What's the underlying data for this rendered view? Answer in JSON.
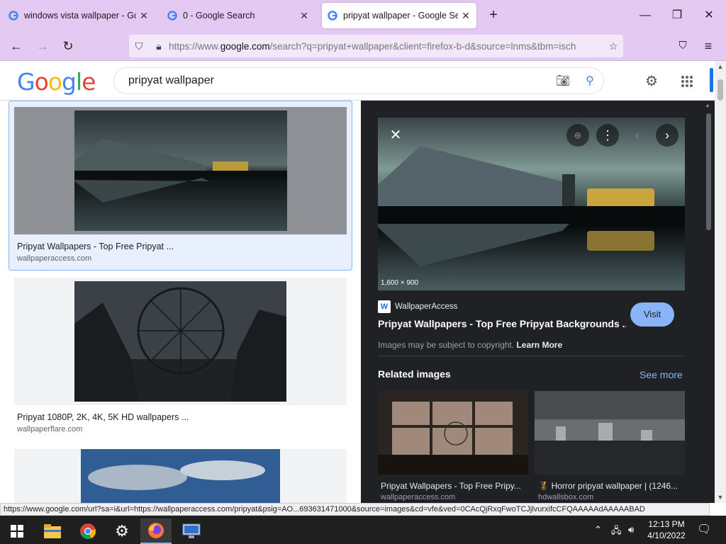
{
  "tabs": [
    {
      "title": "windows vista wallpaper - Goog",
      "active": false
    },
    {
      "title": "0 - Google Search",
      "active": false
    },
    {
      "title": "pripyat wallpaper - Google Sear",
      "active": true
    }
  ],
  "address": {
    "prefix": "https://www.",
    "domain": "google.com",
    "rest": "/search?q=pripyat+wallpaper&client=firefox-b-d&source=lnms&tbm=isch"
  },
  "google": {
    "logo": [
      "G",
      "o",
      "o",
      "g",
      "l",
      "e"
    ],
    "logo_colors": [
      "#4285f4",
      "#ea4335",
      "#fbbc05",
      "#4285f4",
      "#34a853",
      "#ea4335"
    ],
    "query": "pripyat wallpaper"
  },
  "results": [
    {
      "title": "Pripyat Wallpapers - Top Free Pripyat ...",
      "source": "wallpaperaccess.com"
    },
    {
      "title": "Pripyat 1080P, 2K, 4K, 5K HD wallpapers ...",
      "source": "wallpaperflare.com"
    }
  ],
  "panel": {
    "dimensions": "1,600 × 900",
    "source_name": "WallpaperAccess",
    "title": "Pripyat Wallpapers - Top Free Pripyat Backgrounds ...",
    "visit_label": "Visit",
    "copyright": "Images may be subject to copyright.",
    "learn_more": "Learn More",
    "related_heading": "Related images",
    "see_more": "See more",
    "related": [
      {
        "title": "Pripyat Wallpapers - Top Free Pripy...",
        "source": "wallpaperaccess.com"
      },
      {
        "title": "Horror pripyat wallpaper | (1246...",
        "source": "hdwallsbox.com"
      }
    ]
  },
  "status_url": "https://www.google.com/url?sa=i&url=https://wallpaperaccess.com/pripyat&psig=AO...693631471000&source=images&cd=vfe&ved=0CAcQjRxqFwoTCJjlvurxifcCFQAAAAAdAAAAABAD",
  "clock": {
    "time": "12:13 PM",
    "date": "4/10/2022"
  },
  "colors": {
    "tabbar": "#e4c9f2",
    "panel_bg": "#202124",
    "accent_blue": "#8ab4f8",
    "google_blue": "#1a73e8"
  }
}
